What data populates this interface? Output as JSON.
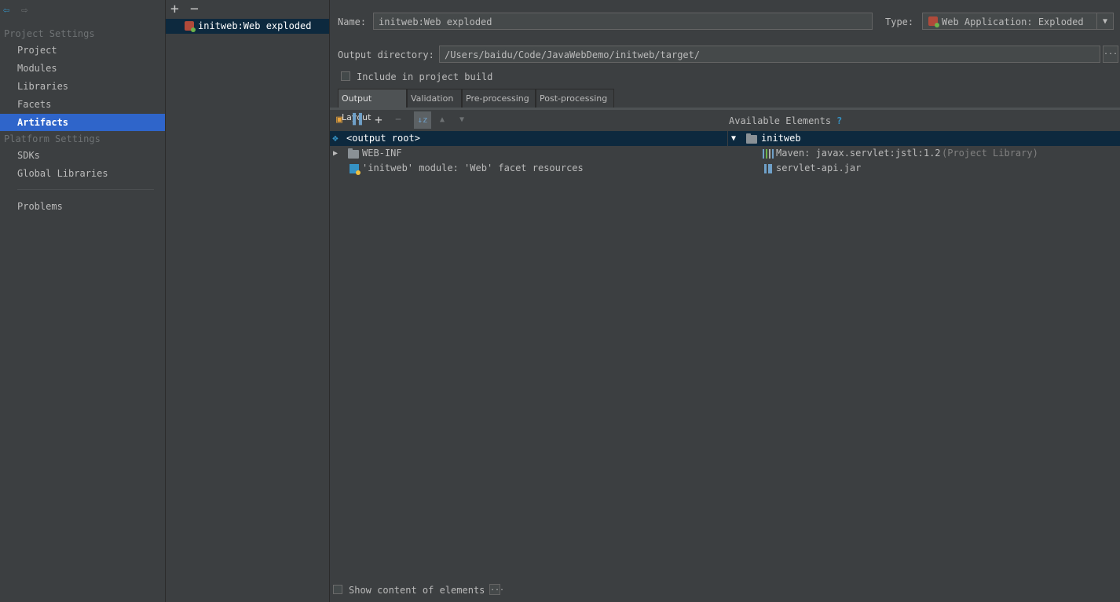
{
  "nav": {
    "back_icon": "back-arrow-icon",
    "forward_icon": "forward-arrow-icon",
    "project_settings_header": "Project Settings",
    "project_items": [
      "Project",
      "Modules",
      "Libraries",
      "Facets",
      "Artifacts"
    ],
    "platform_settings_header": "Platform Settings",
    "platform_items": [
      "SDKs",
      "Global Libraries"
    ],
    "problems": "Problems",
    "selected": "Artifacts"
  },
  "artifacts_list": {
    "add_label": "+",
    "remove_label": "−",
    "items": [
      "initweb:Web exploded"
    ]
  },
  "form": {
    "name_label": "Name:",
    "name_value": "initweb:Web exploded",
    "type_label": "Type:",
    "type_value": "Web Application: Exploded",
    "output_dir_label": "Output directory:",
    "output_dir_value": "/Users/baidu/Code/JavaWebDemo/initweb/target/",
    "browse_label": "...",
    "include_label": "Include in project build"
  },
  "tabs": [
    "Output Layout",
    "Validation",
    "Pre-processing",
    "Post-processing"
  ],
  "layout_tree": {
    "root": "<output root>",
    "items": [
      "WEB-INF",
      "'initweb' module: 'Web' facet resources"
    ]
  },
  "available": {
    "header": "Available Elements",
    "help": "?",
    "module": "initweb",
    "lib_name": "Maven: javax.servlet:jstl:1.2",
    "lib_suffix": "(Project Library)",
    "jar": "servlet-api.jar"
  },
  "footer": {
    "show_content_label": "Show content of elements",
    "more_label": "..."
  },
  "colors": {
    "background": "#3c3f41",
    "selection": "#2f65ca",
    "tree_selection": "#0d293e",
    "accent_blue": "#3592c4"
  }
}
